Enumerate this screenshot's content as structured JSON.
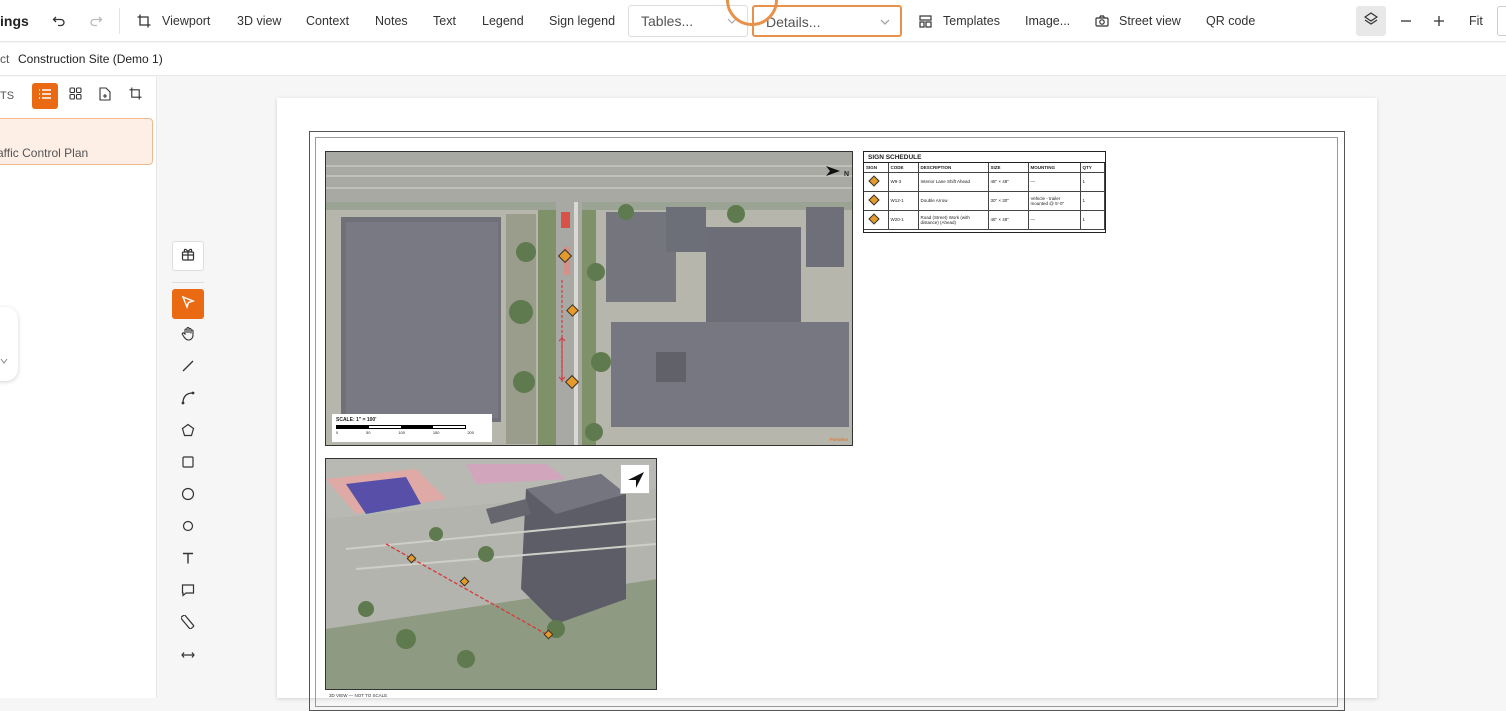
{
  "toolbar": {
    "app_title": "ings",
    "viewport": "Viewport",
    "view3d": "3D view",
    "context": "Context",
    "notes": "Notes",
    "text": "Text",
    "legend": "Legend",
    "sign_legend": "Sign legend",
    "tables_placeholder": "Tables...",
    "details_placeholder": "Details...",
    "templates": "Templates",
    "image": "Image...",
    "street_view": "Street view",
    "qr_code": "QR code",
    "fit": "Fit"
  },
  "breadcrumb": {
    "prefix": "ct",
    "project": "Construction Site (Demo 1)"
  },
  "sidebar": {
    "tab_label": "TS",
    "page_item": "affic Control Plan"
  },
  "tools": [
    "templates-icon",
    "select-icon",
    "hand-icon",
    "line-icon",
    "curve-icon",
    "polygon-icon",
    "rectangle-icon",
    "circle-icon",
    "ellipse-icon",
    "text-icon",
    "comment-icon",
    "measure-icon",
    "dimension-icon"
  ],
  "sheet": {
    "scale_label": "SCALE: 1\" = 100'",
    "scale_ticks": [
      "0",
      "50",
      "100",
      "150",
      "200"
    ],
    "north": "N",
    "footer_note": "3D VIEW — NOT TO SCALE",
    "brand": "Pulseline",
    "sign_schedule": {
      "title": "SIGN SCHEDULE",
      "headers": [
        "SIGN",
        "CODE",
        "DESCRIPTION",
        "SIZE",
        "MOUNTING",
        "QTY"
      ],
      "rows": [
        {
          "code": "W9-3",
          "desc": "Interior Lane Shift Ahead",
          "size": "48\" × 48\"",
          "mount": "—",
          "qty": "1"
        },
        {
          "code": "W12-1",
          "desc": "Double Arrow",
          "size": "30\" × 30\"",
          "mount": "Vehicle - trailer mounted @ 5'-0\"",
          "qty": "1"
        },
        {
          "code": "W20-1",
          "desc": "Road (Street) Work (with distance) (Ahead)",
          "size": "48\" × 48\"",
          "mount": "—",
          "qty": "1"
        }
      ]
    }
  },
  "colors": {
    "accent": "#ea6a13",
    "accent_light": "#fdefe6",
    "sign": "#e69a2a",
    "work_zone": "#d63a3a"
  }
}
